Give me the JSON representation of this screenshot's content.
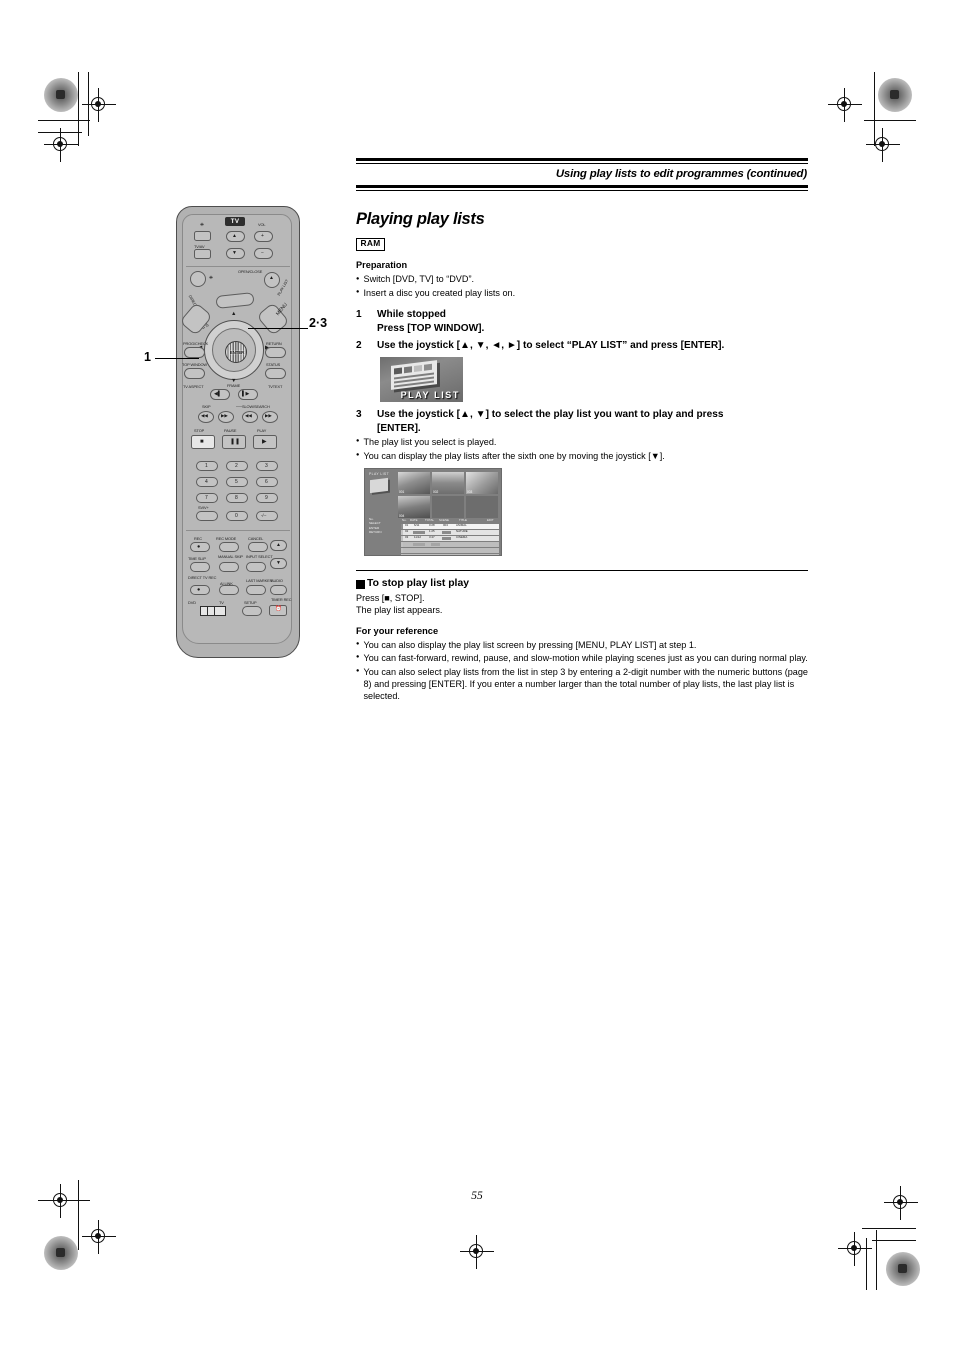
{
  "page": {
    "number": "55",
    "header_title": "Using play lists to edit programmes (continued)"
  },
  "main": {
    "section_title": "Playing play lists",
    "disc_badge": "RAM",
    "preparation_head": "Preparation",
    "preparation_bullets": [
      "Switch [DVD, TV] to “DVD”.",
      "Insert a disc you created play lists on."
    ],
    "steps": [
      {
        "num": "1",
        "lines": [
          "While stopped",
          "Press [TOP WINDOW]."
        ]
      },
      {
        "num": "2",
        "lines": [
          "Use the joystick [▲, ▼, ◄, ►] to select “PLAY LIST” and press [ENTER]."
        ]
      },
      {
        "num": "3",
        "lines": [
          "Use the joystick [▲, ▼] to select the play list you want to play and press",
          "[ENTER]."
        ]
      }
    ],
    "step3_notes": [
      "The play list you select is played.",
      "You can display the play lists after the sixth one by moving the joystick [▼]."
    ],
    "playlist_icon_label": "PLAY  LIST",
    "stop_section": {
      "heading": "To stop play list play",
      "lines": [
        "Press [■, STOP].",
        "The play list appears."
      ]
    },
    "reference_section": {
      "heading": "For your reference",
      "bullets": [
        "You can also display the play list screen by pressing [MENU, PLAY LIST] at step 1.",
        "You can fast-forward, rewind, pause, and slow-motion while playing scenes just as you can during normal play.",
        "You can also select play lists from the list in step 3 by entering a 2-digit number with the numeric buttons (page 8) and pressing [ENTER]. If you enter a number larger than the total number of play lists, the last play list is selected."
      ]
    }
  },
  "tv_screen": {
    "title": "PLAY LIST",
    "thumbnails": [
      {
        "label": "001",
        "empty": false
      },
      {
        "label": "002",
        "empty": false
      },
      {
        "label": "003",
        "empty": false
      },
      {
        "label": "004",
        "empty": false
      },
      {
        "label": "",
        "empty": true
      },
      {
        "label": "",
        "empty": true
      }
    ],
    "columns": [
      "No.",
      "DATE",
      "TOTAL",
      "SCENE",
      "TITLE",
      "EDIT"
    ],
    "rows": [
      {
        "no": "01",
        "date": "6/11",
        "total": "0:28",
        "scene": "004",
        "title": "ANIMAL",
        "blank": false,
        "selected": true
      },
      {
        "no": "02",
        "date": "10/11",
        "total": "1:25",
        "scene": "009",
        "title": "NATURE",
        "blank": false,
        "selected": false
      },
      {
        "no": "03",
        "date": "11/12",
        "total": "3:47",
        "scene": "018",
        "title": "CINEMA",
        "blank": false,
        "selected": false
      },
      {
        "no": "04",
        "date": "",
        "total": "",
        "scene": "",
        "title": "",
        "blank": true,
        "selected": false
      },
      {
        "no": "",
        "date": "",
        "total": "",
        "scene": "",
        "title": "",
        "blank": true,
        "selected": false
      },
      {
        "no": "",
        "date": "",
        "total": "",
        "scene": "",
        "title": "",
        "blank": true,
        "selected": false
      }
    ],
    "guide": [
      "No.",
      "SELECT",
      "ENTER",
      "RETURN"
    ]
  },
  "remote": {
    "tv_tag": "TV",
    "callouts": [
      {
        "id": "1",
        "text": "1"
      },
      {
        "id": "2-3",
        "text": "2·3"
      }
    ],
    "labels": {
      "vol": "VOL",
      "tv_av": "TV/AV",
      "open_close": "OPEN/CLOSE",
      "display": "DISPLAY",
      "menu": "MENU",
      "play_list": "PLAY LIST",
      "top_menu": "TOP MENU",
      "direct_navigator": "DIRECT NAVIGATOR",
      "prog_check": "PROG/CHECK",
      "return": "RETURN",
      "top_window": "TOP WINDOW",
      "status": "STATUS",
      "tv_aspect": "TV ASPECT",
      "frame": "FRAME",
      "tvtext": "TVTEXT",
      "skip": "SKIP",
      "slow_search": "SLOW/SEARCH",
      "stop": "STOP",
      "pause": "PAUSE",
      "play": "PLAY",
      "enter": "ENTER",
      "sv_iv_plus": "SVIV+",
      "rec": "REC",
      "rec_mode": "REC MODE",
      "cancel": "CANCEL",
      "time_slip": "TIME SLIP",
      "manual_skip": "MANUAL SKIP",
      "input_select": "INPUT SELECT",
      "direct_tv_rec": "DIRECT TV REC",
      "ai_link": "AI LINK",
      "last_marker": "LAST MARKER",
      "audio": "AUDIO",
      "dvd": "DVD",
      "tv": "TV",
      "setup": "SETUP",
      "timer_rec": "TIMER REC"
    },
    "numeric_keys": [
      "1",
      "2",
      "3",
      "4",
      "5",
      "6",
      "7",
      "8",
      "9",
      "0",
      "-/--"
    ]
  }
}
